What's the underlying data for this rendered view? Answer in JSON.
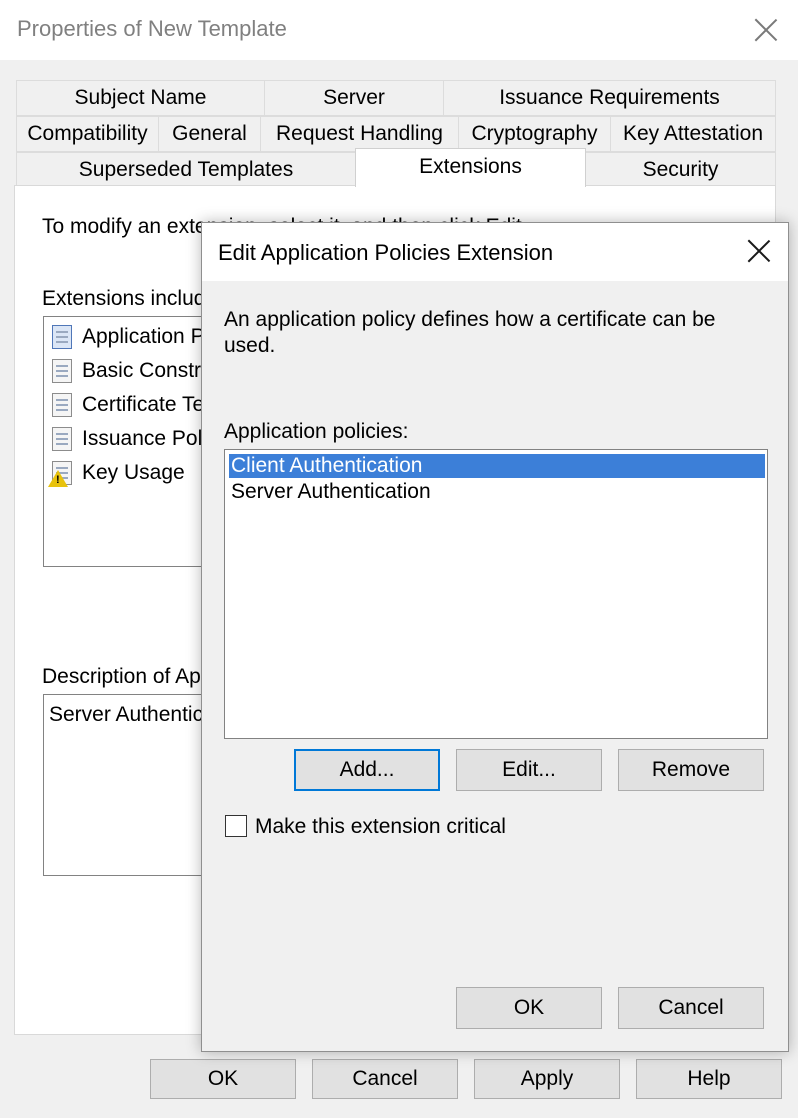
{
  "window": {
    "title": "Properties of New Template",
    "tabs_row1": [
      "Subject Name",
      "Server",
      "Issuance Requirements"
    ],
    "tabs_row2": [
      "Compatibility",
      "General",
      "Request Handling",
      "Cryptography",
      "Key Attestation"
    ],
    "tabs_row3": [
      "Superseded Templates",
      "Extensions",
      "Security"
    ],
    "active_tab": "Extensions"
  },
  "extensions_tab": {
    "instruction": "To modify an extension, select it, and then click Edit.",
    "list_label": "Extensions included in this template:",
    "items": [
      {
        "label": "Application Policies",
        "icon": "extension-icon"
      },
      {
        "label": "Basic Constraints",
        "icon": "extension-icon"
      },
      {
        "label": "Certificate Template Information",
        "icon": "extension-icon"
      },
      {
        "label": "Issuance Policies",
        "icon": "extension-icon"
      },
      {
        "label": "Key Usage",
        "icon": "warning-extension-icon"
      }
    ],
    "description_label": "Description of Application Policies:",
    "description_text": "Server Authentication"
  },
  "footer": {
    "ok": "OK",
    "cancel": "Cancel",
    "apply": "Apply",
    "help": "Help"
  },
  "dialog": {
    "title": "Edit Application Policies Extension",
    "description": "An application policy defines how a certificate can be used.",
    "policies_label": "Application policies:",
    "policies": [
      "Client Authentication",
      "Server Authentication"
    ],
    "selected_policy": "Client Authentication",
    "add": "Add...",
    "edit": "Edit...",
    "remove": "Remove",
    "critical_label": "Make this extension critical",
    "critical_checked": false,
    "ok": "OK",
    "cancel": "Cancel"
  },
  "colors": {
    "selection": "#3c7fd8",
    "focus": "#0078d7",
    "warning": "#e8c20c"
  }
}
